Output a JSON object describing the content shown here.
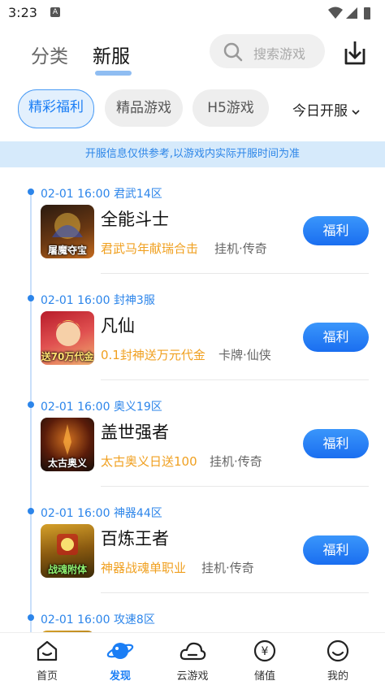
{
  "status_bar": {
    "time": "3:23",
    "a_badge": "A"
  },
  "top_tabs": {
    "fenlei": "分类",
    "xinfu": "新服"
  },
  "search": {
    "placeholder": "搜索游戏"
  },
  "filters": {
    "tabs": [
      "精彩福利",
      "精品游戏",
      "H5游戏"
    ],
    "active": 0,
    "dropdown": "今日开服"
  },
  "notice": "开服信息仅供参考,以游戏内实际开服时间为准",
  "servers": [
    {
      "time": "02-01 16:00",
      "server": "君武14区",
      "name": "全能斗士",
      "promo": "君武马年献瑞合击",
      "genre": "挂机·传奇",
      "icon_caption": "屠魔夺宝",
      "button": "福利",
      "icon_colors": [
        "#2a1a10",
        "#c46a1e"
      ]
    },
    {
      "time": "02-01 16:00",
      "server": "封神3服",
      "name": "凡仙",
      "promo": "0.1封神送万元代金",
      "genre": "卡牌·仙侠",
      "icon_caption": "送70万代金",
      "button": "福利",
      "icon_colors": [
        "#b81c2a",
        "#f0b070"
      ]
    },
    {
      "time": "02-01 16:00",
      "server": "奥义19区",
      "name": "盖世强者",
      "promo": "太古奥义日送100",
      "genre": "挂机·传奇",
      "icon_caption": "太古奥义",
      "button": "福利",
      "icon_colors": [
        "#120d0a",
        "#8a3a12"
      ]
    },
    {
      "time": "02-01 16:00",
      "server": "神器44区",
      "name": "百炼王者",
      "promo": "神器战魂单职业",
      "genre": "挂机·传奇",
      "icon_caption": "战魂附体",
      "button": "福利",
      "icon_colors": [
        "#3a2a08",
        "#d6a12a"
      ]
    },
    {
      "time": "02-01 16:00",
      "server": "攻速8区",
      "name": "",
      "promo": "",
      "genre": "",
      "icon_caption": "",
      "button": "",
      "icon_colors": [
        "#3a2a08",
        "#d6a12a"
      ]
    }
  ],
  "bottom_nav": [
    {
      "label": "首页",
      "icon": "home-face-icon"
    },
    {
      "label": "发现",
      "icon": "planet-icon"
    },
    {
      "label": "云游戏",
      "icon": "cloud-icon"
    },
    {
      "label": "储值",
      "icon": "yen-coin-icon"
    },
    {
      "label": "我的",
      "icon": "smiley-icon"
    }
  ],
  "colors": {
    "accent": "#1b7ef5",
    "promo": "#f0a020",
    "notice_bg": "#d6eafb"
  }
}
